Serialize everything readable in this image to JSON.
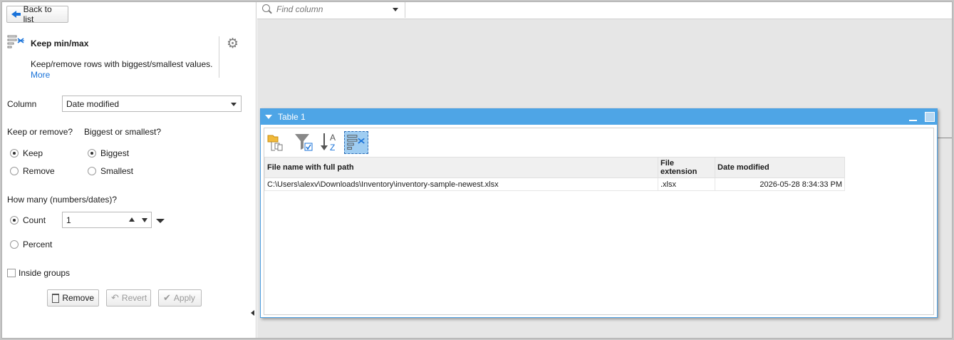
{
  "left_panel": {
    "back_button": "Back to list",
    "tool": {
      "title": "Keep min/max",
      "description": "Keep/remove rows with biggest/smallest values.",
      "more_link": "More"
    },
    "column": {
      "label": "Column",
      "selected": "Date modified"
    },
    "keep_or_remove": {
      "label": "Keep or remove?",
      "options": [
        "Keep",
        "Remove"
      ],
      "selected": "Keep"
    },
    "biggest_or_smallest": {
      "label": "Biggest or smallest?",
      "options": [
        "Biggest",
        "Smallest"
      ],
      "selected": "Biggest"
    },
    "how_many": {
      "label": "How many (numbers/dates)?",
      "count_label": "Count",
      "count_value": "1",
      "percent_label": "Percent",
      "selected": "Count"
    },
    "inside_groups": {
      "label": "Inside groups",
      "checked": false
    },
    "actions": {
      "remove": "Remove",
      "revert": "Revert",
      "apply": "Apply"
    }
  },
  "find_bar": {
    "placeholder": "Find column"
  },
  "table_window": {
    "title": "Table 1",
    "toolbar_icons": [
      "open-file-icon",
      "filter-icon",
      "sort-icon",
      "keep-min-max-icon"
    ],
    "columns": [
      "File name with full path",
      "File extension",
      "Date modified"
    ],
    "rows": [
      [
        "C:\\Users\\alexv\\Downloads\\Inventory\\inventory-sample-newest.xlsx",
        ".xlsx",
        "2026-05-28 8:34:33 PM"
      ]
    ]
  },
  "colors": {
    "accent": "#1a73d9",
    "title_bar": "#4ea5e6",
    "selected_tool": "#9fcdf2"
  }
}
